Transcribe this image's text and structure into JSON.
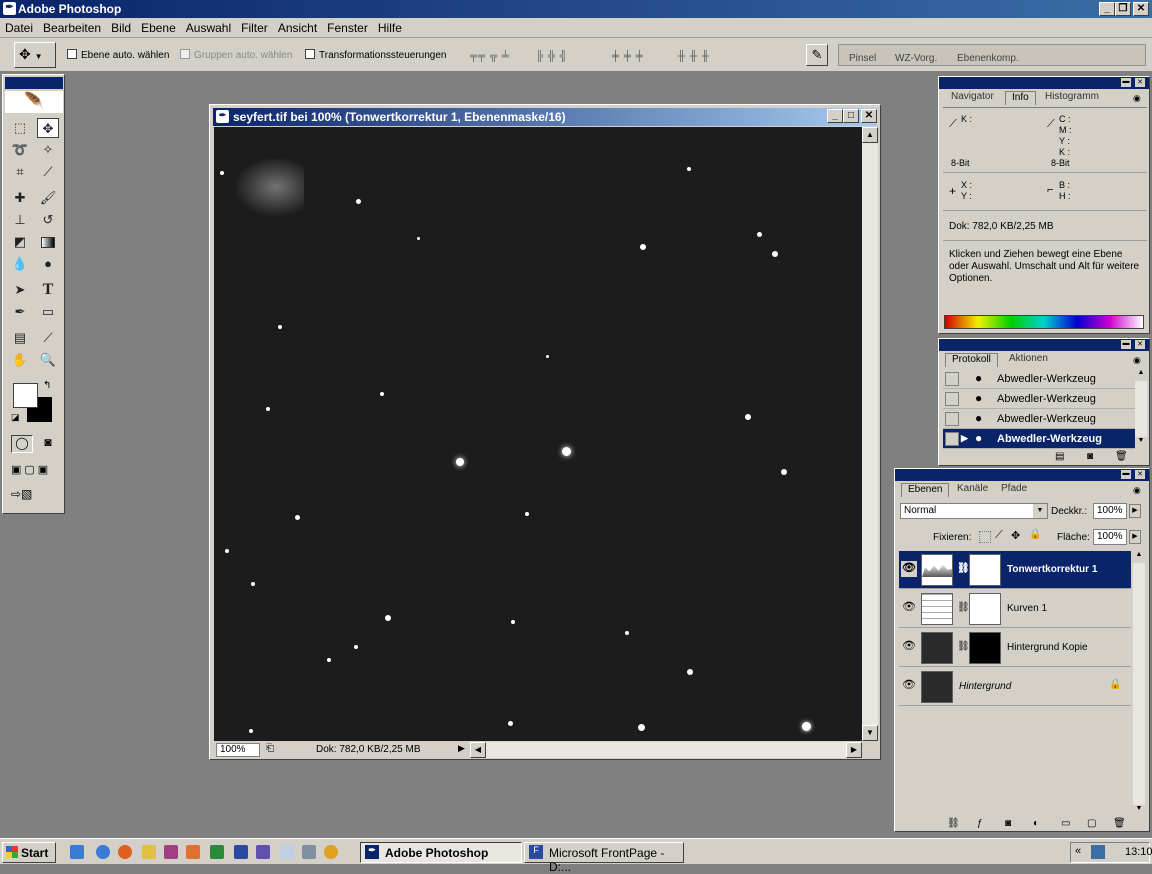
{
  "app": {
    "title": "Adobe Photoshop"
  },
  "menu": [
    "Datei",
    "Bearbeiten",
    "Bild",
    "Ebene",
    "Auswahl",
    "Filter",
    "Ansicht",
    "Fenster",
    "Hilfe"
  ],
  "options": {
    "auto_select_layer": "Ebene auto. wählen",
    "auto_select_groups": "Gruppen auto. wählen",
    "transform_controls": "Transformationssteuerungen",
    "palette_well": [
      "Pinsel",
      "WZ-Vorg.",
      "Ebenenkomp."
    ]
  },
  "document": {
    "title": "seyfert.tif bei 100% (Tonwertkorrektur 1, Ebenenmaske/16)",
    "zoom": "100%",
    "status": "Dok: 782,0 KB/2,25 MB"
  },
  "info_panel": {
    "tabs": [
      "Navigator",
      "Info",
      "Histogramm"
    ],
    "active_tab": "Info",
    "k_label": "K :",
    "c_label": "C :",
    "m_label": "M :",
    "y_label": "Y :",
    "k2_label": "K :",
    "bit_left": "8-Bit",
    "bit_right": "8-Bit",
    "x_label": "X :",
    "y2_label": "Y :",
    "b_label": "B :",
    "h_label": "H :",
    "doc_size": "Dok: 782,0 KB/2,25 MB",
    "hint": "Klicken und Ziehen bewegt eine Ebene oder Auswahl. Umschalt und Alt für weitere Optionen."
  },
  "history_panel": {
    "tabs": [
      "Protokoll",
      "Aktionen"
    ],
    "items": [
      "Abwedler-Werkzeug",
      "Abwedler-Werkzeug",
      "Abwedler-Werkzeug",
      "Abwedler-Werkzeug"
    ]
  },
  "layers_panel": {
    "tabs": [
      "Ebenen",
      "Kanäle",
      "Pfade"
    ],
    "blend_mode": "Normal",
    "opacity_label": "Deckkr.:",
    "opacity": "100%",
    "lock_label": "Fixieren:",
    "fill_label": "Fläche:",
    "fill": "100%",
    "layers": [
      "Tonwertkorrektur 1",
      "Kurven 1",
      "Hintergrund Kopie",
      "Hintergrund"
    ]
  },
  "taskbar": {
    "start": "Start",
    "items": [
      "Adobe Photoshop",
      "Microsoft FrontPage - D:..."
    ],
    "time": "13:10"
  },
  "colors": {
    "accent": "#0a246a",
    "chrome": "#d4d0c8"
  }
}
